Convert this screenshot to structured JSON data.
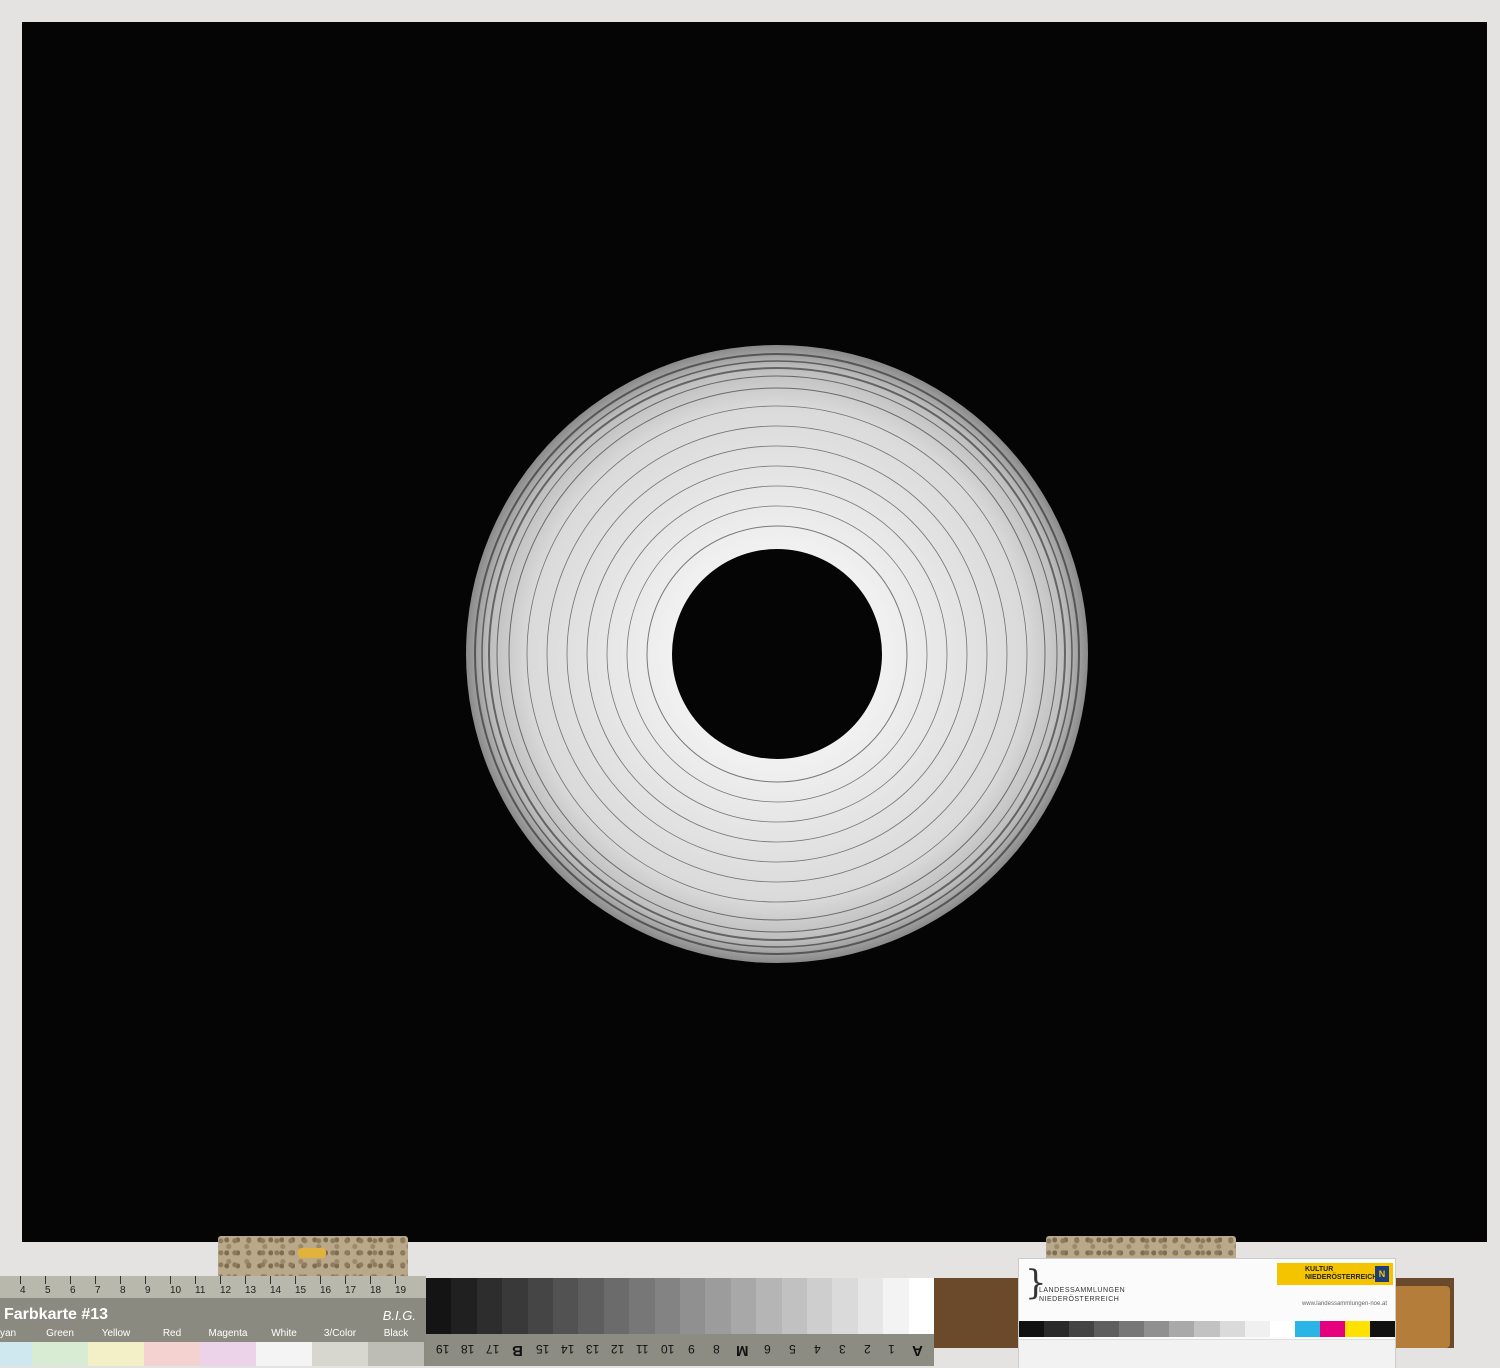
{
  "farbkarte": {
    "title": "Farbkarte #13",
    "brand": "B.I.G.",
    "ruler_numbers": [
      "4",
      "5",
      "6",
      "7",
      "8",
      "9",
      "10",
      "11",
      "12",
      "13",
      "14",
      "15",
      "16",
      "17",
      "18",
      "19"
    ],
    "color_labels": [
      "yan",
      "Green",
      "Yellow",
      "Red",
      "Magenta",
      "White",
      "3/Color",
      "Black"
    ],
    "patch_colors": [
      "#cfe8ef",
      "#d7ecd3",
      "#f3f0c8",
      "#f3d2cf",
      "#ecd3ea",
      "#f4f4f4",
      "#d7d7cf",
      "#bdbdb5"
    ]
  },
  "greyscale": {
    "numbers": [
      "19",
      "18",
      "17",
      "B",
      "15",
      "14",
      "13",
      "12",
      "11",
      "10",
      "9",
      "8",
      "M",
      "6",
      "5",
      "4",
      "3",
      "2",
      "1",
      "A"
    ]
  },
  "card": {
    "name_line1": "LANDESSAMMLUNGEN",
    "name_line2": "NIEDERÖSTERREICH",
    "kultur_line1": "KULTUR",
    "kultur_line2": "NIEDERÖSTERREICH",
    "noe_mark": "N",
    "url": "www.landessammlungen-noe.at"
  }
}
